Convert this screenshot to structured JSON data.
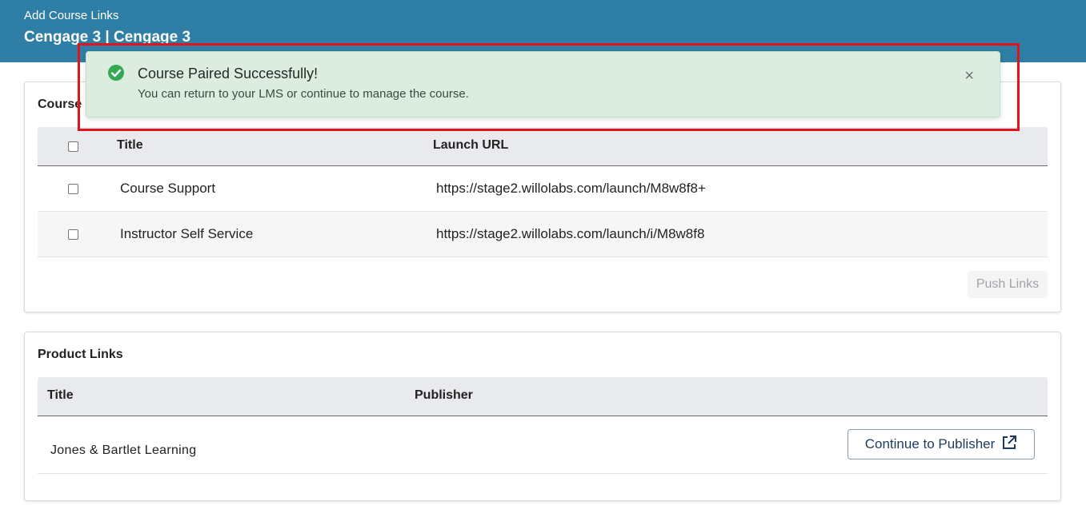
{
  "header": {
    "subtitle": "Add Course Links",
    "title": "Cengage 3 | Cengage 3"
  },
  "course_links": {
    "heading": "Course Links",
    "columns": {
      "title": "Title",
      "launch_url": "Launch URL"
    },
    "rows": [
      {
        "title": "Course Support",
        "url": "https://stage2.willolabs.com/launch/M8w8f8+"
      },
      {
        "title": "Instructor Self Service",
        "url": "https://stage2.willolabs.com/launch/i/M8w8f8"
      }
    ],
    "push_button": "Push Links"
  },
  "product_links": {
    "heading": "Product Links",
    "columns": {
      "title": "Title",
      "publisher": "Publisher"
    },
    "rows": [
      {
        "title": "Jones & Bartlet Learning",
        "button": "Continue to Publisher"
      }
    ]
  },
  "toast": {
    "title": "Course Paired Successfully!",
    "message": "You can return to your LMS or continue to manage the course.",
    "close_symbol": "×",
    "icon": "check-circle-icon",
    "color": "#dcede0"
  },
  "colors": {
    "header": "#2f7ea5",
    "success": "#34a853",
    "highlight": "#e0141b"
  }
}
